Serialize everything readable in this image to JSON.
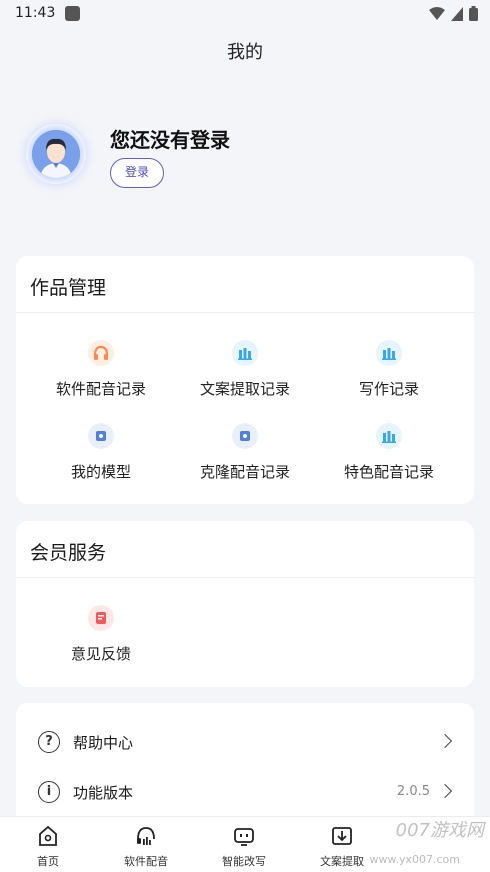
{
  "status_bar": {
    "time": "11:43"
  },
  "page_title": "我的",
  "profile": {
    "name": "您还没有登录",
    "login_label": "登录"
  },
  "works_card": {
    "title": "作品管理",
    "items": [
      {
        "label": "软件配音记录",
        "icon": "headphones-icon"
      },
      {
        "label": "文案提取记录",
        "icon": "bar-chart-icon"
      },
      {
        "label": "写作记录",
        "icon": "bar-chart-icon"
      },
      {
        "label": "我的模型",
        "icon": "model-icon"
      },
      {
        "label": "克隆配音记录",
        "icon": "model-icon"
      },
      {
        "label": "特色配音记录",
        "icon": "bar-chart-icon"
      }
    ]
  },
  "member_card": {
    "title": "会员服务",
    "items": [
      {
        "label": "意见反馈",
        "icon": "feedback-icon"
      }
    ]
  },
  "settings": {
    "help_label": "帮助中心",
    "version_label": "功能版本",
    "version_value": "2.0.5"
  },
  "tabbar": {
    "tabs": [
      {
        "label": "首页",
        "icon": "home-icon"
      },
      {
        "label": "软件配音",
        "icon": "dubbing-icon"
      },
      {
        "label": "智能改写",
        "icon": "rewrite-icon"
      },
      {
        "label": "文案提取",
        "icon": "extract-icon"
      }
    ]
  },
  "watermark": {
    "text": "007游戏网",
    "sub": "www.yx007.com"
  },
  "colors": {
    "accent": "#5e5fcf",
    "background": "#f4f5f9",
    "headphones": "#ff8a4c",
    "chart": "#3aa8e6",
    "feedback": "#f05a5a"
  }
}
